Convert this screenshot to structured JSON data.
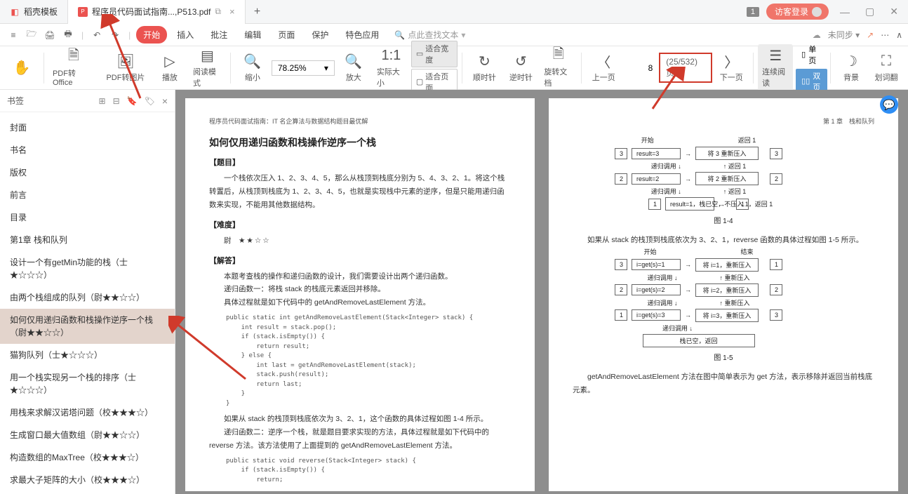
{
  "tabs": {
    "tab1": {
      "label": "稻壳模板"
    },
    "tab2": {
      "label": "程序员代码面试指南...,P513.pdf"
    }
  },
  "title_right": {
    "badge": "1",
    "login": "访客登录"
  },
  "menubar": {
    "start": "开始",
    "insert": "插入",
    "annotate": "批注",
    "edit": "编辑",
    "page": "页面",
    "protect": "保护",
    "special": "特色应用",
    "search_placeholder": "点此查找文本",
    "sync": "未同步"
  },
  "ribbon": {
    "pdf_office": "PDF转Office",
    "pdf_image": "PDF转图片",
    "play": "播放",
    "read_mode": "阅读模式",
    "zoom_out": "缩小",
    "zoom": "78.25%",
    "zoom_in": "放大",
    "actual": "实际大小",
    "fit_width": "适合宽度",
    "fit_page": "适合页面",
    "cw": "顺时针",
    "ccw": "逆时针",
    "rotate_doc": "旋转文档",
    "prev": "上一页",
    "next": "下一页",
    "page_input": "8",
    "page_count": "(25/532) 页",
    "continuous": "连续阅读",
    "single": "单页",
    "double": "双页",
    "background": "背景",
    "underline": "划词翻"
  },
  "sidebar": {
    "title": "书签",
    "items": [
      "封面",
      "书名",
      "版权",
      "前言",
      "目录",
      "第1章 栈和队列",
      "设计一个有getMin功能的栈（士★☆☆☆）",
      "由两个栈组成的队列（尉★★☆☆）",
      "如何仅用递归函数和栈操作逆序一个栈（尉★★☆☆）",
      "猫狗队列（士★☆☆☆）",
      "用一个栈实现另一个栈的排序（士★☆☆☆）",
      "用栈来求解汉诺塔问题（校★★★☆）",
      "生成窗口最大值数组（尉★★☆☆）",
      "构造数组的MaxTree（校★★★☆）",
      "求最大子矩阵的大小（校★★★☆）"
    ],
    "selected_index": 8
  },
  "page_left": {
    "header": "程序员代码面试指南：IT 名企算法与数据结构题目最优解",
    "title": "如何仅用递归函数和栈操作逆序一个栈",
    "sect_problem": "【题目】",
    "problem": "一个栈依次压入 1、2、3、4、5，那么从栈顶到栈底分别为 5、4、3、2、1。将这个栈转置后，从栈顶到栈底为 1、2、3、4、5，也就是实现栈中元素的逆序，但是只能用递归函数来实现，不能用其他数据结构。",
    "sect_diff": "【难度】",
    "diff_label": "尉",
    "diff_stars": "★★☆☆",
    "sect_answer": "【解答】",
    "ans_p1": "本题考查栈的操作和递归函数的设计，我们需要设计出两个递归函数。",
    "ans_p2": "递归函数一：将栈 stack 的栈底元素返回并移除。",
    "ans_p3": "具体过程就是如下代码中的 getAndRemoveLastElement 方法。",
    "code1": "public static int getAndRemoveLastElement(Stack<Integer> stack) {\n    int result = stack.pop();\n    if (stack.isEmpty()) {\n        return result;\n    } else {\n        int last = getAndRemoveLastElement(stack);\n        stack.push(result);\n        return last;\n    }\n}",
    "ans_p4": "如果从 stack 的栈顶到栈底依次为 3、2、1，这个函数的具体过程如图 1-4 所示。",
    "ans_p5": "递归函数二：逆序一个栈，就是题目要求实现的方法，具体过程就是如下代码中的 reverse 方法。该方法使用了上面提到的 getAndRemoveLastElement 方法。",
    "code2": "public static void reverse(Stack<Integer> stack) {\n    if (stack.isEmpty()) {\n        return;"
  },
  "page_right": {
    "header_right": "第 1 章　栈和队列",
    "dia1": {
      "start": "开始",
      "ret1": "返回 1",
      "rows": [
        {
          "n": "3",
          "cell": "result=3",
          "act": "将 3 重新压入",
          "side": "3"
        },
        {
          "lbl": "递归调用",
          "rlbl": "返回 1"
        },
        {
          "n": "2",
          "cell": "result=2",
          "act": "将 2 重新压入",
          "side": "2"
        },
        {
          "lbl": "递归调用",
          "rlbl": "返回 1"
        },
        {
          "n": "1",
          "cell": "result=1，栈已空，不压入 1，返回 1",
          "side": "1"
        }
      ],
      "caption": "图 1-4"
    },
    "mid_text": "如果从 stack 的栈顶到栈底依次为 3、2、1，reverse 函数的具体过程如图 1-5 所示。",
    "dia2": {
      "start": "开始",
      "end": "结束",
      "rows": [
        {
          "n": "3",
          "cell": "i=get(s)=1",
          "act": "将 i=1，重新压入",
          "side": "1"
        },
        {
          "lbl": "递归调用",
          "rlbl": "重新压入"
        },
        {
          "n": "2",
          "cell": "i=get(s)=2",
          "act": "将 i=2，重新压入",
          "side": "2"
        },
        {
          "lbl": "递归调用",
          "rlbl": "重新压入"
        },
        {
          "n": "1",
          "cell": "i=get(s)=3",
          "act": "将 i=3，重新压入",
          "side": "3"
        },
        {
          "lbl": "递归调用"
        },
        {
          "final": "栈已空，返回"
        }
      ],
      "caption": "图 1-5"
    },
    "bottom": "getAndRemoveLastElement 方法在图中简单表示为 get 方法，表示移除并返回当前栈底元素。"
  }
}
